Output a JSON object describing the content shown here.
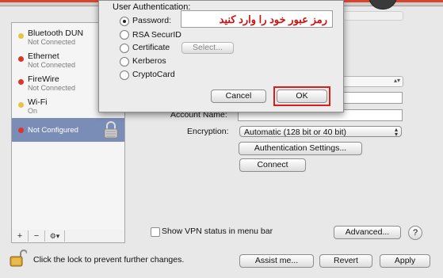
{
  "sidebar": {
    "services": [
      {
        "name": "Bluetooth DUN",
        "status": "Not Connected",
        "color": "#e9c244"
      },
      {
        "name": "Ethernet",
        "status": "Not Connected",
        "color": "#d9352b"
      },
      {
        "name": "FireWire",
        "status": "Not Connected",
        "color": "#d9352b"
      },
      {
        "name": "Wi-Fi",
        "status": "On",
        "color": "#e9c244"
      },
      {
        "name": "Not Configured",
        "status": "",
        "color": "#d9352b"
      }
    ],
    "add_label": "+",
    "remove_label": "−",
    "action_label": "⚙▾"
  },
  "config": {
    "account_name_label": "Account Name:",
    "account_name_value": "",
    "encryption_label": "Encryption:",
    "encryption_value": "Automatic (128 bit or 40 bit)",
    "auth_settings_label": "Authentication Settings...",
    "connect_label": "Connect",
    "show_vpn_label": "Show VPN status in menu bar",
    "advanced_label": "Advanced...",
    "help_label": "?"
  },
  "sheet": {
    "title": "User Authentication:",
    "options": [
      {
        "label": "Password:",
        "selected": true
      },
      {
        "label": "RSA SecurID",
        "selected": false
      },
      {
        "label": "Certificate",
        "selected": false
      },
      {
        "label": "Kerberos",
        "selected": false
      },
      {
        "label": "CryptoCard",
        "selected": false
      }
    ],
    "password_value": "رمز عبور خود را وارد کنید",
    "select_label": "Select...",
    "cancel_label": "Cancel",
    "ok_label": "OK",
    "highlight_color": "#e01b1b"
  },
  "footer": {
    "lock_text": "Click the lock to prevent further changes.",
    "assist_label": "Assist me...",
    "revert_label": "Revert",
    "apply_label": "Apply"
  }
}
